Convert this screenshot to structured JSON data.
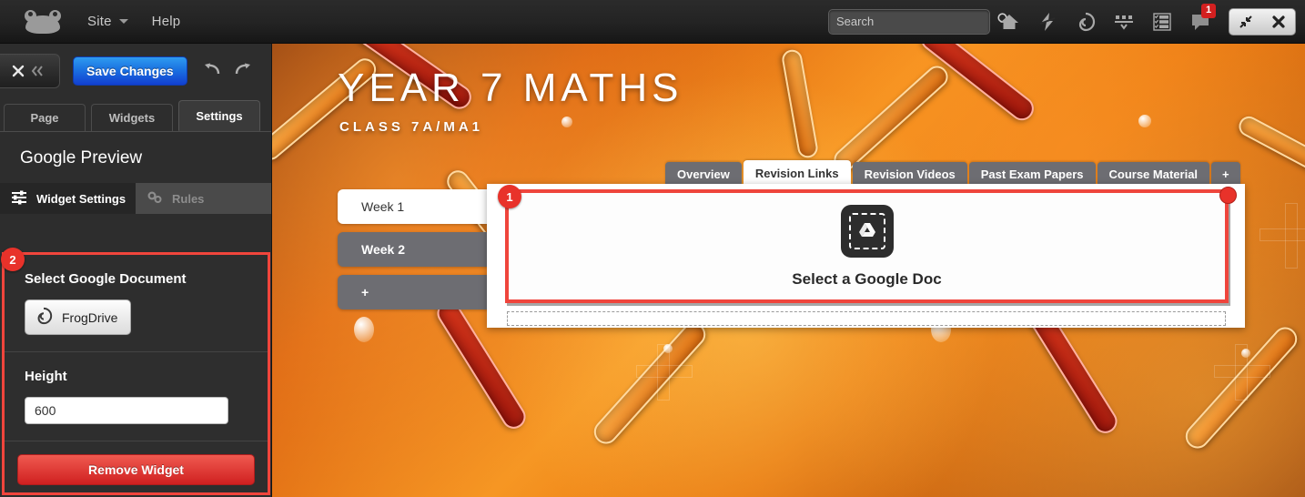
{
  "topbar": {
    "logo_name": "frog-logo",
    "site_label": "Site",
    "help_label": "Help",
    "search": {
      "value": "",
      "placeholder": "Search"
    },
    "icons": [
      {
        "name": "home-icon",
        "label": "Home"
      },
      {
        "name": "flash-icon",
        "label": "Flash"
      },
      {
        "name": "frogdrive-icon",
        "label": "FrogDrive"
      },
      {
        "name": "apps-icon",
        "label": "Apps"
      },
      {
        "name": "tasks-icon",
        "label": "Tasks"
      }
    ],
    "chat": {
      "name": "chat-icon",
      "badge": "1"
    },
    "window": {
      "restore": "restore-icon",
      "close": "close-icon"
    }
  },
  "leftpanel": {
    "close_label": "",
    "save_label": "Save Changes",
    "undo_label": "Undo",
    "redo_label": "Redo",
    "tabs": [
      {
        "label": "Page",
        "active": false
      },
      {
        "label": "Widgets",
        "active": false
      },
      {
        "label": "Settings",
        "active": true
      }
    ],
    "title": "Google Preview",
    "subtabs": [
      {
        "label": "Widget Settings",
        "icon": "sliders-icon",
        "active": true
      },
      {
        "label": "Rules",
        "icon": "gears-icon",
        "active": false
      }
    ],
    "settings": {
      "document_label": "Select Google Document",
      "frogdrive_button": "FrogDrive",
      "height_label": "Height",
      "height_value": "600",
      "height_placeholder": "600",
      "remove_label": "Remove Widget"
    },
    "marker": "2"
  },
  "site": {
    "title": "YEAR 7 MATHS",
    "subtitle": "CLASS 7A/MA1",
    "tabs": [
      {
        "label": "Overview",
        "active": false
      },
      {
        "label": "Revision Links",
        "active": true
      },
      {
        "label": "Revision Videos",
        "active": false
      },
      {
        "label": "Past Exam Papers",
        "active": false
      },
      {
        "label": "Course Material",
        "active": false
      },
      {
        "label": "+",
        "active": false
      }
    ],
    "weeks": [
      {
        "label": "Week 1",
        "active": true
      },
      {
        "label": "Week 2",
        "active": false
      },
      {
        "label": "+",
        "active": false
      }
    ],
    "widget": {
      "marker": "1",
      "icon_name": "google-drive-icon",
      "cta": "Select a Google Doc"
    }
  },
  "colors": {
    "accent_blue": "#1a6fe0",
    "highlight_red": "#ef453c",
    "danger_red": "#d02020",
    "panel_dark": "#2d2d2d",
    "site_orange": "#e8760f"
  }
}
